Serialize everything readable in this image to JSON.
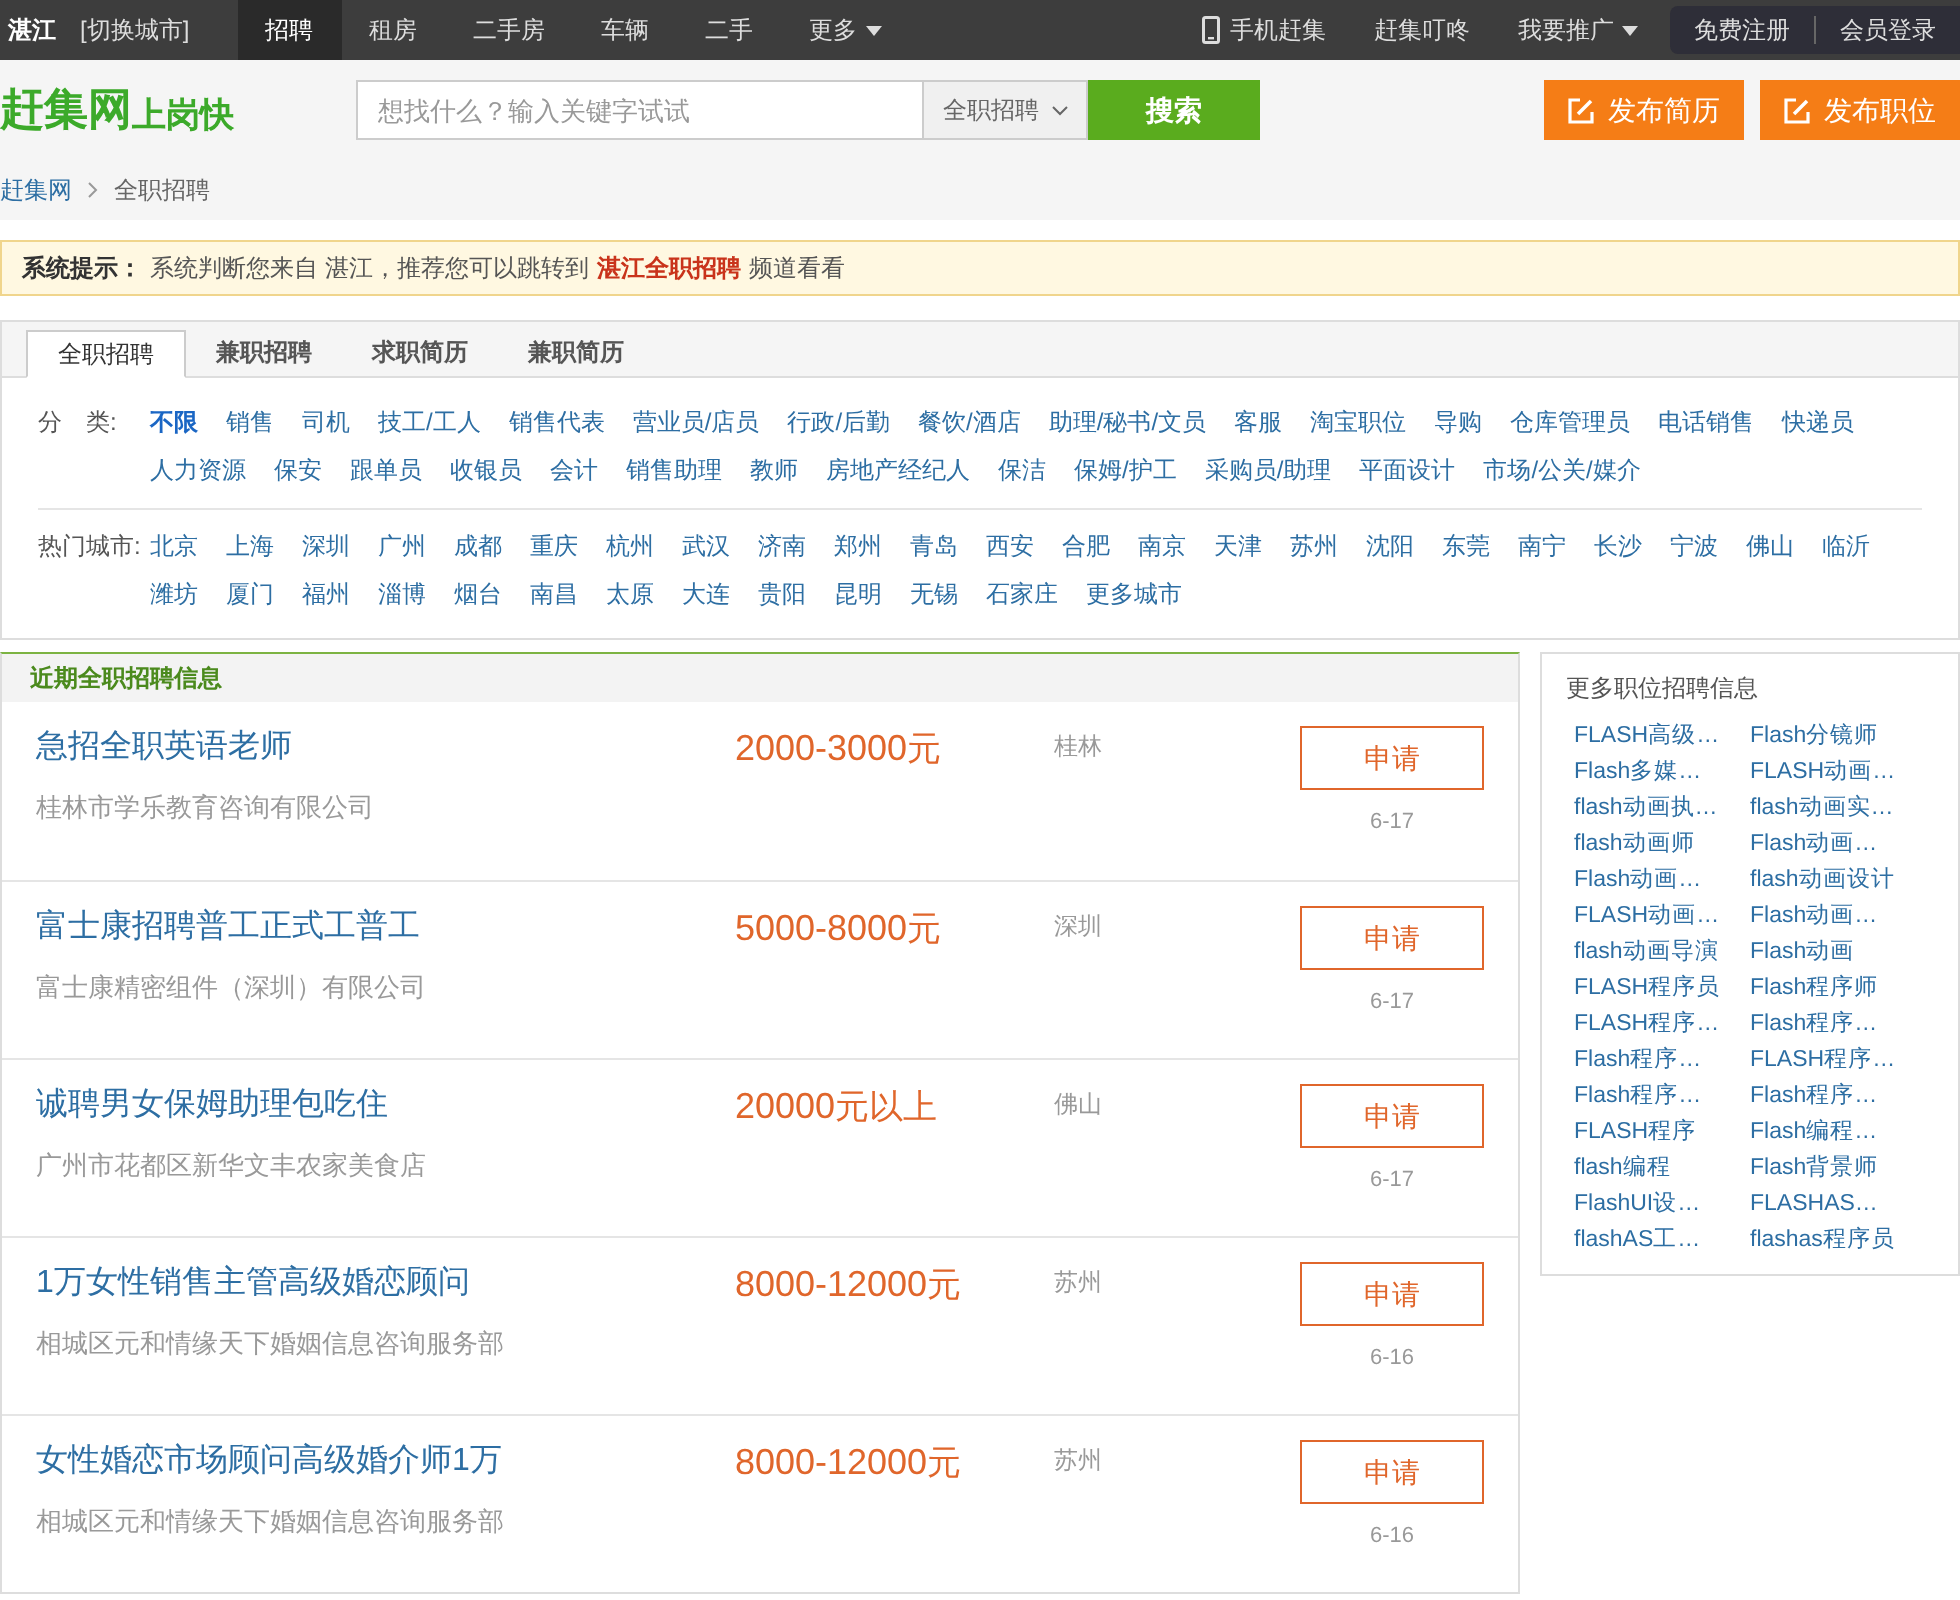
{
  "topbar": {
    "city": "湛江",
    "switch_city": "[切换城市]",
    "nav": [
      {
        "label": "招聘",
        "selected": true,
        "dropdown": false
      },
      {
        "label": "租房",
        "selected": false,
        "dropdown": false
      },
      {
        "label": "二手房",
        "selected": false,
        "dropdown": false
      },
      {
        "label": "车辆",
        "selected": false,
        "dropdown": false
      },
      {
        "label": "二手",
        "selected": false,
        "dropdown": false
      },
      {
        "label": "更多",
        "selected": false,
        "dropdown": true
      }
    ],
    "right": [
      {
        "label": "手机赶集",
        "kind": "phone"
      },
      {
        "label": "赶集叮咚",
        "kind": "plain"
      },
      {
        "label": "我要推广",
        "kind": "dropdown"
      }
    ],
    "account": [
      "免费注册",
      "会员登录"
    ]
  },
  "header": {
    "logo": "赶集网",
    "slogan": "上岗快",
    "search_placeholder": "想找什么？输入关键字试试",
    "category": "全职招聘",
    "search_button": "搜索",
    "actions": [
      "发布简历",
      "发布职位"
    ]
  },
  "breadcrumb": [
    "赶集网",
    "全职招聘"
  ],
  "notice": {
    "label": "系统提示：",
    "text": "系统判断您来自 湛江，推荐您可以跳转到",
    "link": "湛江全职招聘",
    "suffix": "频道看看"
  },
  "tabs": [
    {
      "label": "全职招聘",
      "selected": true
    },
    {
      "label": "兼职招聘",
      "selected": false
    },
    {
      "label": "求职简历",
      "selected": false
    },
    {
      "label": "兼职简历",
      "selected": false
    }
  ],
  "filters": [
    {
      "label": "分　类:",
      "items": [
        {
          "label": "不限",
          "selected": true
        },
        {
          "label": "销售",
          "selected": false
        },
        {
          "label": "司机",
          "selected": false
        },
        {
          "label": "技工/工人",
          "selected": false
        },
        {
          "label": "销售代表",
          "selected": false
        },
        {
          "label": "营业员/店员",
          "selected": false
        },
        {
          "label": "行政/后勤",
          "selected": false
        },
        {
          "label": "餐饮/酒店",
          "selected": false
        },
        {
          "label": "助理/秘书/文员",
          "selected": false
        },
        {
          "label": "客服",
          "selected": false
        },
        {
          "label": "淘宝职位",
          "selected": false
        },
        {
          "label": "导购",
          "selected": false
        },
        {
          "label": "仓库管理员",
          "selected": false
        },
        {
          "label": "电话销售",
          "selected": false
        },
        {
          "label": "快递员",
          "selected": false
        },
        {
          "label": "人力资源",
          "selected": false
        },
        {
          "label": "保安",
          "selected": false
        },
        {
          "label": "跟单员",
          "selected": false
        },
        {
          "label": "收银员",
          "selected": false
        },
        {
          "label": "会计",
          "selected": false
        },
        {
          "label": "销售助理",
          "selected": false
        },
        {
          "label": "教师",
          "selected": false
        },
        {
          "label": "房地产经纪人",
          "selected": false
        },
        {
          "label": "保洁",
          "selected": false
        },
        {
          "label": "保姆/护工",
          "selected": false
        },
        {
          "label": "采购员/助理",
          "selected": false
        },
        {
          "label": "平面设计",
          "selected": false
        },
        {
          "label": "市场/公关/媒介",
          "selected": false
        }
      ]
    },
    {
      "label": "热门城市:",
      "items": [
        {
          "label": "北京",
          "selected": false
        },
        {
          "label": "上海",
          "selected": false
        },
        {
          "label": "深圳",
          "selected": false
        },
        {
          "label": "广州",
          "selected": false
        },
        {
          "label": "成都",
          "selected": false
        },
        {
          "label": "重庆",
          "selected": false
        },
        {
          "label": "杭州",
          "selected": false
        },
        {
          "label": "武汉",
          "selected": false
        },
        {
          "label": "济南",
          "selected": false
        },
        {
          "label": "郑州",
          "selected": false
        },
        {
          "label": "青岛",
          "selected": false
        },
        {
          "label": "西安",
          "selected": false
        },
        {
          "label": "合肥",
          "selected": false
        },
        {
          "label": "南京",
          "selected": false
        },
        {
          "label": "天津",
          "selected": false
        },
        {
          "label": "苏州",
          "selected": false
        },
        {
          "label": "沈阳",
          "selected": false
        },
        {
          "label": "东莞",
          "selected": false
        },
        {
          "label": "南宁",
          "selected": false
        },
        {
          "label": "长沙",
          "selected": false
        },
        {
          "label": "宁波",
          "selected": false
        },
        {
          "label": "佛山",
          "selected": false
        },
        {
          "label": "临沂",
          "selected": false
        },
        {
          "label": "潍坊",
          "selected": false
        },
        {
          "label": "厦门",
          "selected": false
        },
        {
          "label": "福州",
          "selected": false
        },
        {
          "label": "淄博",
          "selected": false
        },
        {
          "label": "烟台",
          "selected": false
        },
        {
          "label": "南昌",
          "selected": false
        },
        {
          "label": "太原",
          "selected": false
        },
        {
          "label": "大连",
          "selected": false
        },
        {
          "label": "贵阳",
          "selected": false
        },
        {
          "label": "昆明",
          "selected": false
        },
        {
          "label": "无锡",
          "selected": false
        },
        {
          "label": "石家庄",
          "selected": false
        },
        {
          "label": "更多城市",
          "selected": false
        }
      ]
    }
  ],
  "listings": {
    "title": "近期全职招聘信息",
    "jobs": [
      {
        "title": "急招全职英语老师",
        "company": "桂林市学乐教育咨询有限公司",
        "salary": "2000-3000",
        "unit": "元",
        "city": "桂林",
        "apply": "申请",
        "date": "6-17"
      },
      {
        "title": "富士康招聘普工正式工普工",
        "company": "富士康精密组件（深圳）有限公司",
        "salary": "5000-8000",
        "unit": "元",
        "city": "深圳",
        "apply": "申请",
        "date": "6-17"
      },
      {
        "title": "诚聘男女保姆助理包吃住",
        "company": "广州市花都区新华文丰农家美食店",
        "salary": "20000",
        "unit": "元以上",
        "city": "佛山",
        "apply": "申请",
        "date": "6-17"
      },
      {
        "title": "1万女性销售主管高级婚恋顾问",
        "company": "相城区元和情缘天下婚姻信息咨询服务部",
        "salary": "8000-12000",
        "unit": "元",
        "city": "苏州",
        "apply": "申请",
        "date": "6-16"
      },
      {
        "title": "女性婚恋市场顾问高级婚介师1万",
        "company": "相城区元和情缘天下婚姻信息咨询服务部",
        "salary": "8000-12000",
        "unit": "元",
        "city": "苏州",
        "apply": "申请",
        "date": "6-16"
      }
    ]
  },
  "sidebar": {
    "title": "更多职位招聘信息",
    "links": [
      "FLASH高级…",
      "Flash分镜师",
      "Flash多媒…",
      "FLASH动画…",
      "flash动画执…",
      "flash动画实…",
      "flash动画师",
      "Flash动画…",
      "Flash动画…",
      "flash动画设计",
      "FLASH动画…",
      "Flash动画…",
      "flash动画导演",
      "Flash动画",
      "FLASH程序员",
      "Flash程序师",
      "FLASH程序…",
      "Flash程序…",
      "Flash程序…",
      "FLASH程序…",
      "Flash程序…",
      "Flash程序…",
      "FLASH程序",
      "Flash编程…",
      "flash编程",
      "Flash背景师",
      "FlashUI设…",
      "FLASHAS…",
      "flashAS工…",
      "flashas程序员"
    ]
  }
}
